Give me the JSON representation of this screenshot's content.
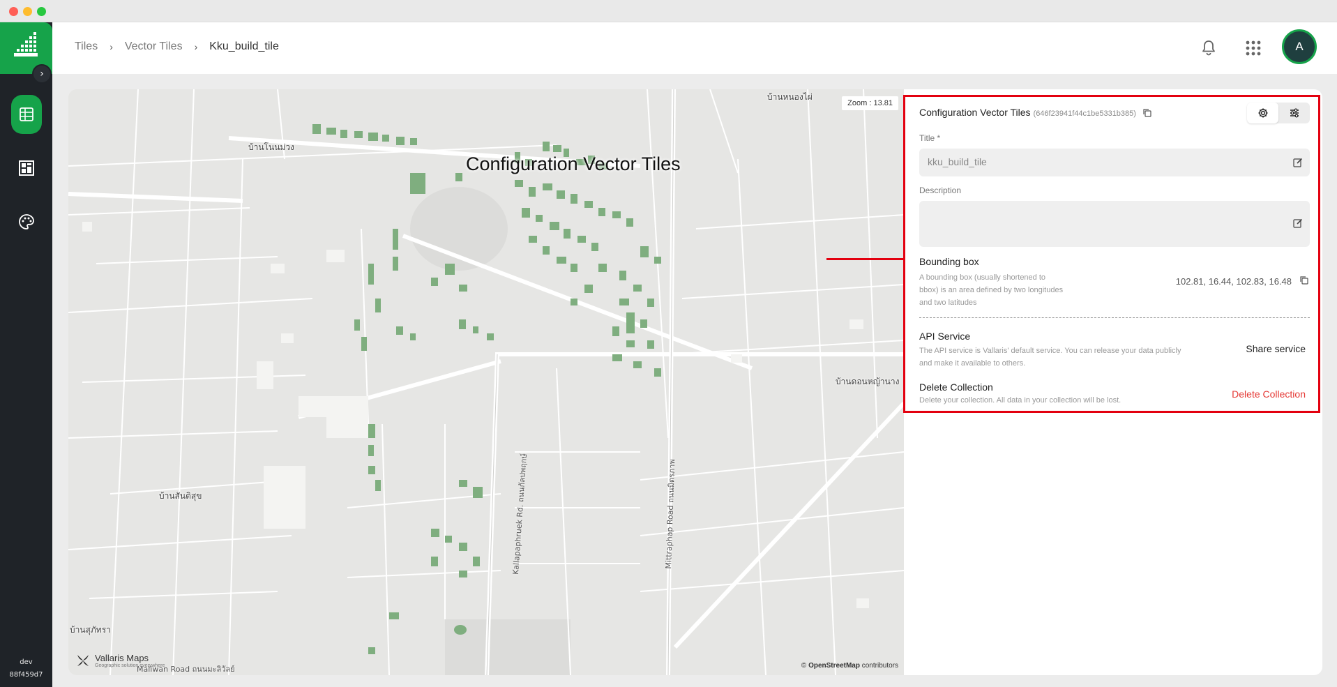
{
  "sidebar": {
    "items": [
      {
        "name": "vector-tiles",
        "active": true
      },
      {
        "name": "dashboard",
        "active": false
      },
      {
        "name": "styles",
        "active": false
      }
    ],
    "env": "dev",
    "build": "88f459d7"
  },
  "breadcrumb": [
    "Tiles",
    "Vector Tiles",
    "Kku_build_tile"
  ],
  "header": {
    "avatar_initial": "A"
  },
  "map": {
    "zoom_label": "Zoom : 13.81",
    "places": [
      "บ้านโนนม่วง",
      "บ้านหนองไผ่",
      "บ้านดอนหญ้านาง",
      "บ้านสันติสุข",
      "บ้านสุภัทรา"
    ],
    "roads": [
      "Kallapaphruek Rd. ถนนกัลปพฤกษ์",
      "Mittraphap Road ถนนมิตรภาพ",
      "Maliwan Road ถนนมะลิวัลย์"
    ],
    "brand": "Vallaris Maps",
    "brand_sub": "Geographic solution everywhere",
    "attribution_prefix": "©",
    "attribution_link": "OpenStreetMap",
    "attribution_suffix": "contributors"
  },
  "annotation": {
    "label": "Configuration Vector Tiles",
    "color": "#e3000f"
  },
  "config": {
    "title": "Configuration Vector Tiles",
    "id": "(646f23941f44c1be5331b385)",
    "title_label": "Title *",
    "title_value": "kku_build_tile",
    "description_label": "Description",
    "description_value": "",
    "bbox_title": "Bounding box",
    "bbox_desc": "A bounding box (usually shortened to bbox) is an area defined by two longitudes and two latitudes",
    "bbox_value": "102.81, 16.44, 102.83, 16.48",
    "api_title": "API Service",
    "api_desc": "The API service is Vallaris' default service. You can release your data publicly and make it available to others.",
    "share_label": "Share service",
    "delete_title": "Delete Collection",
    "delete_desc": "Delete your collection. All data in your collection will be lost.",
    "delete_label": "Delete Collection"
  },
  "colors": {
    "brand_green": "#16a34a",
    "sidebar_bg": "#1f2328",
    "danger": "#e53935",
    "building": "#7fae7f"
  }
}
